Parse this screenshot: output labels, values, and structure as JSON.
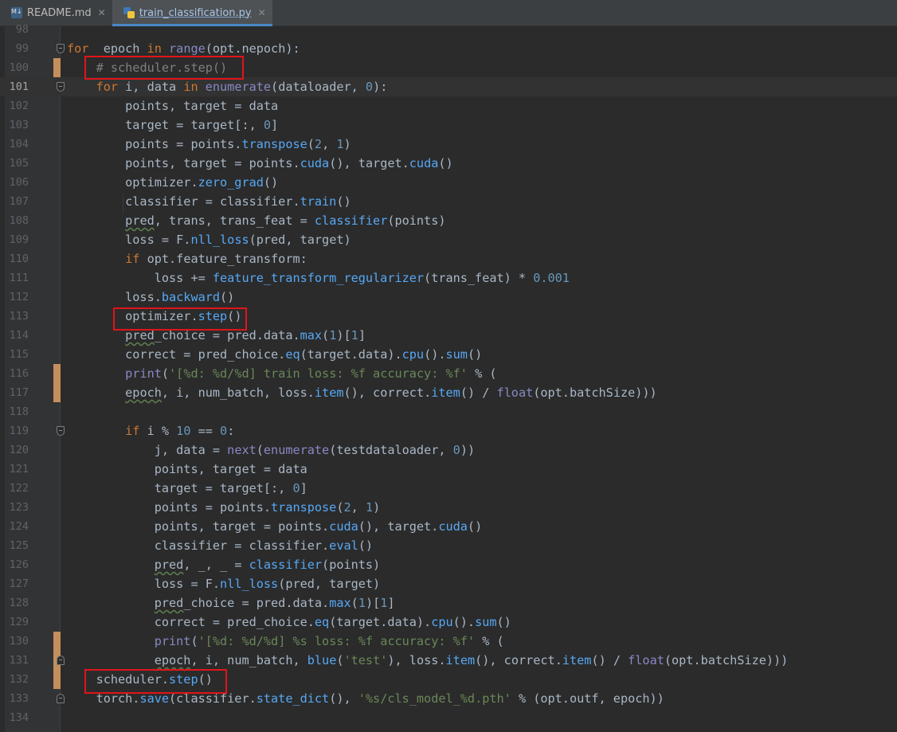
{
  "tabs": [
    {
      "label": "README.md",
      "active": false
    },
    {
      "label": "train_classification.py",
      "active": true
    }
  ],
  "colors": {
    "keyword": "#cc7832",
    "builtin": "#8888c6",
    "function": "#56a8f5",
    "number": "#6897bb",
    "string": "#6a8759",
    "comment": "#808080",
    "highlight_box": "#e0141a",
    "change_marker": "#c58e5d"
  },
  "editor": {
    "current_line": "101",
    "lines": [
      {
        "n": "98",
        "tokens": []
      },
      {
        "n": "99",
        "tokens": [
          [
            "kw",
            "for"
          ],
          [
            "",
            "  epoch "
          ],
          [
            "kw",
            "in"
          ],
          [
            "bi",
            " range"
          ],
          [
            "",
            "(opt.nepoch):"
          ]
        ]
      },
      {
        "n": "100",
        "tokens": [
          [
            "",
            "    "
          ],
          [
            "cm",
            "# scheduler.step()"
          ]
        ]
      },
      {
        "n": "101",
        "tokens": [
          [
            "",
            "    "
          ],
          [
            "kw",
            "for"
          ],
          [
            "",
            " i, data "
          ],
          [
            "kw",
            "in"
          ],
          [
            "bi",
            " enumerate"
          ],
          [
            "",
            "(dataloader, "
          ],
          [
            "nm",
            "0"
          ],
          [
            "",
            "):"
          ]
        ]
      },
      {
        "n": "102",
        "tokens": [
          [
            "",
            "        points, target = data"
          ]
        ]
      },
      {
        "n": "103",
        "tokens": [
          [
            "",
            "        target = target[:, "
          ],
          [
            "nm",
            "0"
          ],
          [
            "",
            "]"
          ]
        ]
      },
      {
        "n": "104",
        "tokens": [
          [
            "",
            "        points = points."
          ],
          [
            "fn",
            "transpose"
          ],
          [
            "",
            "("
          ],
          [
            "nm",
            "2"
          ],
          [
            "",
            ", "
          ],
          [
            "nm",
            "1"
          ],
          [
            "",
            ")"
          ]
        ]
      },
      {
        "n": "105",
        "tokens": [
          [
            "",
            "        points, target = points."
          ],
          [
            "fn",
            "cuda"
          ],
          [
            "",
            "(), target."
          ],
          [
            "fn",
            "cuda"
          ],
          [
            "",
            "()"
          ]
        ]
      },
      {
        "n": "106",
        "tokens": [
          [
            "",
            "        optimizer."
          ],
          [
            "fn",
            "zero_grad"
          ],
          [
            "",
            "()"
          ]
        ]
      },
      {
        "n": "107",
        "tokens": [
          [
            "",
            "        classifier = classifier."
          ],
          [
            "fn",
            "train"
          ],
          [
            "",
            "()"
          ]
        ]
      },
      {
        "n": "108",
        "tokens": [
          [
            "",
            "        "
          ],
          [
            "wv",
            "pred"
          ],
          [
            "",
            ", trans, trans_feat = "
          ],
          [
            "fn",
            "classifier"
          ],
          [
            "",
            "(points)"
          ]
        ]
      },
      {
        "n": "109",
        "tokens": [
          [
            "",
            "        loss = F."
          ],
          [
            "fn",
            "nll_loss"
          ],
          [
            "",
            "(pred, target)"
          ]
        ]
      },
      {
        "n": "110",
        "tokens": [
          [
            "",
            "        "
          ],
          [
            "kw",
            "if"
          ],
          [
            "",
            " opt.feature_transform:"
          ]
        ]
      },
      {
        "n": "111",
        "tokens": [
          [
            "",
            "            loss += "
          ],
          [
            "fn",
            "feature_transform_regularizer"
          ],
          [
            "",
            "(trans_feat) * "
          ],
          [
            "nm",
            "0.001"
          ]
        ]
      },
      {
        "n": "112",
        "tokens": [
          [
            "",
            "        loss."
          ],
          [
            "fn",
            "backward"
          ],
          [
            "",
            "()"
          ]
        ]
      },
      {
        "n": "113",
        "tokens": [
          [
            "",
            "        optimizer."
          ],
          [
            "fn",
            "step"
          ],
          [
            "",
            "()"
          ]
        ]
      },
      {
        "n": "114",
        "tokens": [
          [
            "",
            "        "
          ],
          [
            "wv",
            "pred"
          ],
          [
            "",
            "_choice = pred.data."
          ],
          [
            "fn",
            "max"
          ],
          [
            "",
            "("
          ],
          [
            "nm",
            "1"
          ],
          [
            "",
            ")["
          ],
          [
            "nm",
            "1"
          ],
          [
            "",
            "]"
          ]
        ]
      },
      {
        "n": "115",
        "tokens": [
          [
            "",
            "        correct = pred_choice."
          ],
          [
            "fn",
            "eq"
          ],
          [
            "",
            "(target.data)."
          ],
          [
            "fn",
            "cpu"
          ],
          [
            "",
            "()."
          ],
          [
            "fn",
            "sum"
          ],
          [
            "",
            "()"
          ]
        ]
      },
      {
        "n": "116",
        "tokens": [
          [
            "",
            "        "
          ],
          [
            "bi",
            "print"
          ],
          [
            "",
            "("
          ],
          [
            "st",
            "'[%d: %d/%d] train loss: %f accuracy: %f'"
          ],
          [
            "",
            " % ("
          ]
        ]
      },
      {
        "n": "117",
        "tokens": [
          [
            "",
            "        "
          ],
          [
            "wv",
            "epoch"
          ],
          [
            "",
            ", i, num_batch, loss."
          ],
          [
            "fn",
            "item"
          ],
          [
            "",
            "(), correct."
          ],
          [
            "fn",
            "item"
          ],
          [
            "",
            "() / "
          ],
          [
            "bi",
            "float"
          ],
          [
            "",
            "(opt.batchSize)))"
          ]
        ]
      },
      {
        "n": "118",
        "tokens": []
      },
      {
        "n": "119",
        "tokens": [
          [
            "",
            "        "
          ],
          [
            "kw",
            "if"
          ],
          [
            "",
            " i % "
          ],
          [
            "nm",
            "10"
          ],
          [
            "",
            " == "
          ],
          [
            "nm",
            "0"
          ],
          [
            "",
            ":"
          ]
        ]
      },
      {
        "n": "120",
        "tokens": [
          [
            "",
            "            j, data = "
          ],
          [
            "bi",
            "next"
          ],
          [
            "",
            "("
          ],
          [
            "bi",
            "enumerate"
          ],
          [
            "",
            "(testdataloader, "
          ],
          [
            "nm",
            "0"
          ],
          [
            "",
            "))"
          ]
        ]
      },
      {
        "n": "121",
        "tokens": [
          [
            "",
            "            points, target = data"
          ]
        ]
      },
      {
        "n": "122",
        "tokens": [
          [
            "",
            "            target = target[:, "
          ],
          [
            "nm",
            "0"
          ],
          [
            "",
            "]"
          ]
        ]
      },
      {
        "n": "123",
        "tokens": [
          [
            "",
            "            points = points."
          ],
          [
            "fn",
            "transpose"
          ],
          [
            "",
            "("
          ],
          [
            "nm",
            "2"
          ],
          [
            "",
            ", "
          ],
          [
            "nm",
            "1"
          ],
          [
            "",
            ")"
          ]
        ]
      },
      {
        "n": "124",
        "tokens": [
          [
            "",
            "            points, target = points."
          ],
          [
            "fn",
            "cuda"
          ],
          [
            "",
            "(), target."
          ],
          [
            "fn",
            "cuda"
          ],
          [
            "",
            "()"
          ]
        ]
      },
      {
        "n": "125",
        "tokens": [
          [
            "",
            "            classifier = classifier."
          ],
          [
            "fn",
            "eval"
          ],
          [
            "",
            "()"
          ]
        ]
      },
      {
        "n": "126",
        "tokens": [
          [
            "",
            "            "
          ],
          [
            "wv",
            "pred"
          ],
          [
            "",
            ", _, _ = "
          ],
          [
            "fn",
            "classifier"
          ],
          [
            "",
            "(points)"
          ]
        ]
      },
      {
        "n": "127",
        "tokens": [
          [
            "",
            "            loss = F."
          ],
          [
            "fn",
            "nll_loss"
          ],
          [
            "",
            "(pred, target)"
          ]
        ]
      },
      {
        "n": "128",
        "tokens": [
          [
            "",
            "            "
          ],
          [
            "wv",
            "pred"
          ],
          [
            "",
            "_choice = pred.data."
          ],
          [
            "fn",
            "max"
          ],
          [
            "",
            "("
          ],
          [
            "nm",
            "1"
          ],
          [
            "",
            ")["
          ],
          [
            "nm",
            "1"
          ],
          [
            "",
            "]"
          ]
        ]
      },
      {
        "n": "129",
        "tokens": [
          [
            "",
            "            correct = pred_choice."
          ],
          [
            "fn",
            "eq"
          ],
          [
            "",
            "(target.data)."
          ],
          [
            "fn",
            "cpu"
          ],
          [
            "",
            "()."
          ],
          [
            "fn",
            "sum"
          ],
          [
            "",
            "()"
          ]
        ]
      },
      {
        "n": "130",
        "tokens": [
          [
            "",
            "            "
          ],
          [
            "bi",
            "print"
          ],
          [
            "",
            "("
          ],
          [
            "st",
            "'[%d: %d/%d] %s loss: %f accuracy: %f'"
          ],
          [
            "",
            " % ("
          ]
        ]
      },
      {
        "n": "131",
        "tokens": [
          [
            "",
            "            "
          ],
          [
            "wv",
            "epoch"
          ],
          [
            "",
            ", i, num_batch, "
          ],
          [
            "fn",
            "blue"
          ],
          [
            "",
            "("
          ],
          [
            "st",
            "'test'"
          ],
          [
            "",
            "), loss."
          ],
          [
            "fn",
            "item"
          ],
          [
            "",
            "(), correct."
          ],
          [
            "fn",
            "item"
          ],
          [
            "",
            "() / "
          ],
          [
            "bi",
            "float"
          ],
          [
            "",
            "(opt.batchSize)))"
          ]
        ]
      },
      {
        "n": "132",
        "tokens": [
          [
            "",
            "    scheduler."
          ],
          [
            "fn",
            "step"
          ],
          [
            "",
            "()"
          ]
        ]
      },
      {
        "n": "133",
        "tokens": [
          [
            "",
            "    torch."
          ],
          [
            "fn",
            "save"
          ],
          [
            "",
            "(classifier."
          ],
          [
            "fn",
            "state_dict"
          ],
          [
            "",
            "(), "
          ],
          [
            "st",
            "'%s/cls_model_%d.pth'"
          ],
          [
            "",
            " % (opt.outf, epoch))"
          ]
        ]
      },
      {
        "n": "134",
        "tokens": []
      }
    ]
  }
}
